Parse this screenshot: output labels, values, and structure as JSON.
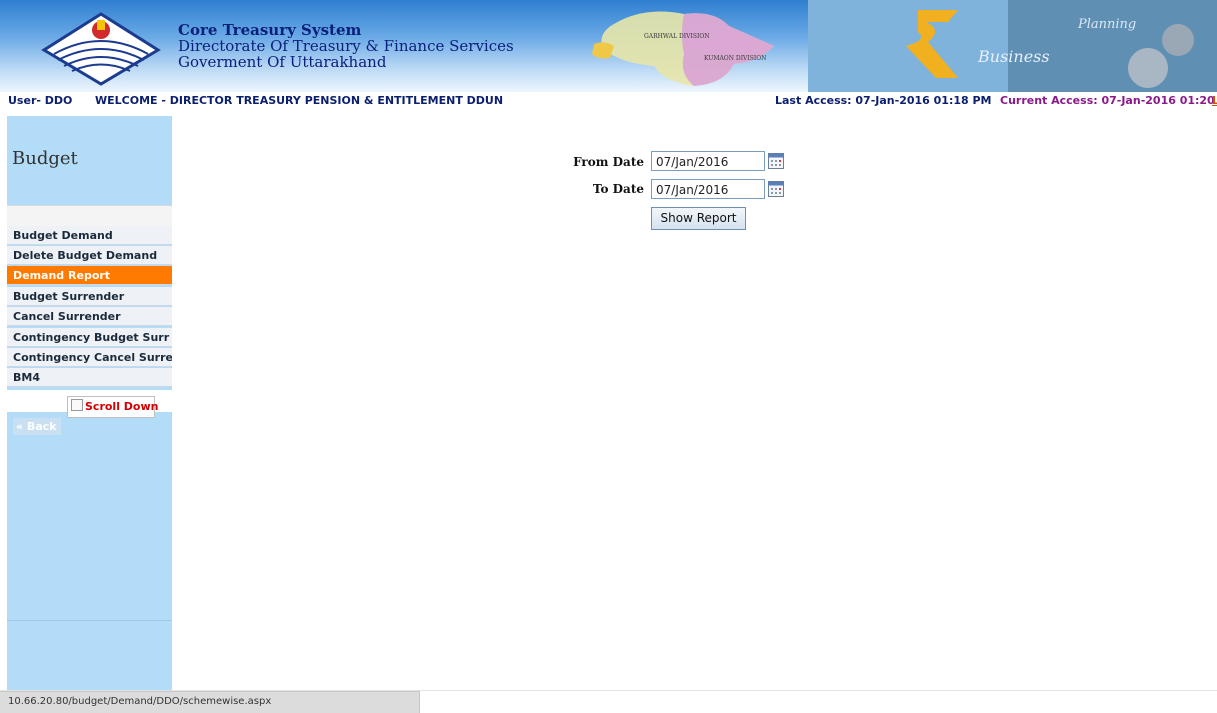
{
  "header": {
    "title_line1": "Core Treasury System",
    "title_line2": "Directorate Of Treasury & Finance Services",
    "title_line3": "Goverment Of Uttarakhand",
    "map_label_garhwal": "GARHWAL DIVISION",
    "map_label_kumaon": "KUMAON DIVISION",
    "deco_text_business": "Business",
    "deco_text_planning": "Planning"
  },
  "userbar": {
    "user": "User- DDO",
    "welcome": "WELCOME - DIRECTOR TREASURY PENSION & ENTITLEMENT DDUN",
    "last_access": "Last Access: 07-Jan-2016 01:18 PM",
    "current_access": "Current Access: 07-Jan-2016 01:20",
    "logout_fragment": "L"
  },
  "sidebar": {
    "title": "Budget",
    "items": [
      {
        "label": "Budget Demand",
        "active": false
      },
      {
        "label": "Delete Budget Demand",
        "active": false
      },
      {
        "label": "Demand Report",
        "active": true
      },
      {
        "label": "Budget Surrender",
        "active": false
      },
      {
        "label": "Cancel Surrender",
        "active": false
      },
      {
        "label": "Contingency Budget Surr",
        "active": false
      },
      {
        "label": "Contingency Cancel Surre",
        "active": false
      },
      {
        "label": "BM4",
        "active": false
      }
    ],
    "scroll_down": "Scroll Down",
    "back": "« Back"
  },
  "form": {
    "from_label": "From Date",
    "from_value": "07/Jan/2016",
    "to_label": "To Date",
    "to_value": "07/Jan/2016",
    "show_report": "Show Report"
  },
  "status": {
    "url": "10.66.20.80/budget/Demand/DDO/schemewise.aspx"
  },
  "colors": {
    "active_menu": "#ff7a00",
    "sidebar_bg": "#b3dcf8",
    "header_text": "#0a1f7a"
  }
}
